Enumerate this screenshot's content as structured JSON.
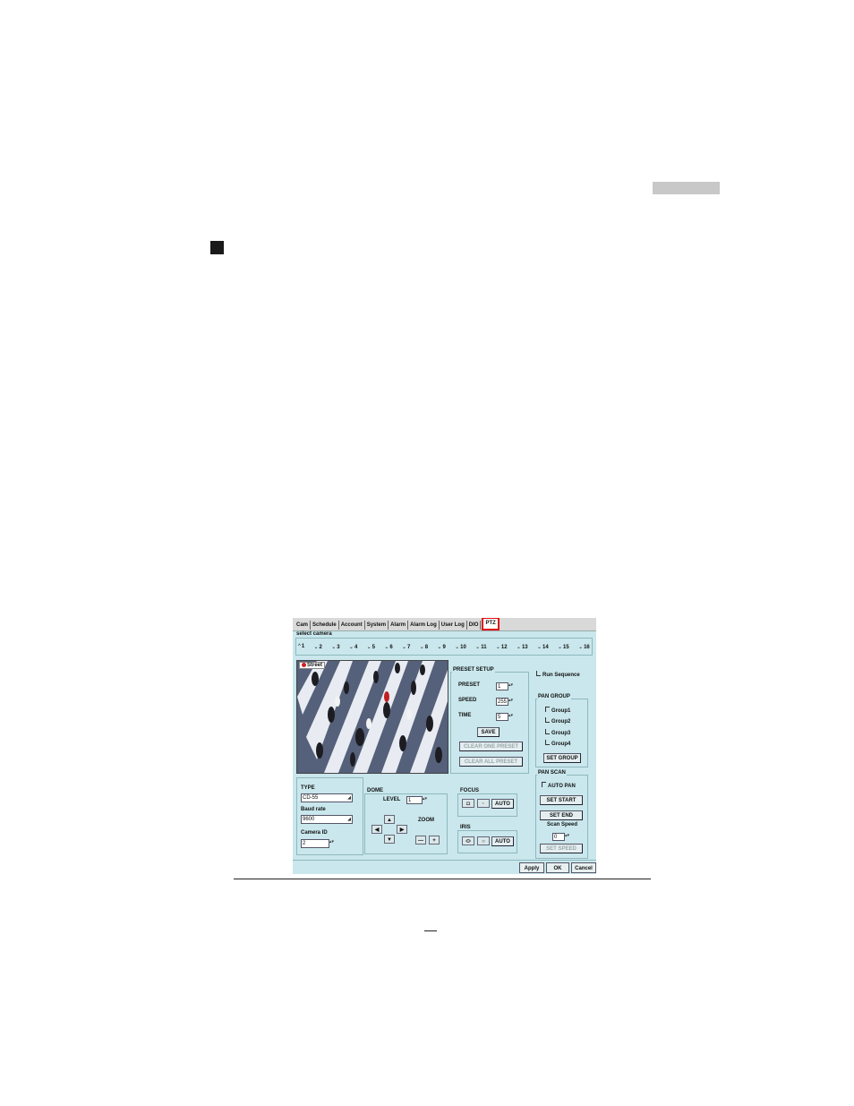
{
  "tabs": [
    {
      "label": "Cam"
    },
    {
      "label": "Schedule"
    },
    {
      "label": "Account"
    },
    {
      "label": "System"
    },
    {
      "label": "Alarm"
    },
    {
      "label": "Alarm Log"
    },
    {
      "label": "User Log"
    },
    {
      "label": "DIO"
    },
    {
      "label": "PTZ",
      "active": true
    }
  ],
  "select_camera_label": "select camera",
  "cameras": [
    "1",
    "2",
    "3",
    "4",
    "5",
    "6",
    "7",
    "8",
    "9",
    "10",
    "11",
    "12",
    "13",
    "14",
    "15",
    "16"
  ],
  "selected_camera": "1",
  "video": {
    "label": "Street"
  },
  "preset_setup": {
    "title": "PRESET SETUP",
    "preset_label": "PRESET",
    "preset_value": "1",
    "speed_label": "SPEED",
    "speed_value": "255",
    "time_label": "TIME",
    "time_value": "5",
    "save": "SAVE",
    "clear_one": "CLEAR ONE PRESET",
    "clear_all": "CLEAR ALL PRESET"
  },
  "run_sequence": "Run Sequence",
  "pan_group": {
    "title": "PAN GROUP",
    "groups": [
      {
        "label": "Group1",
        "checked": true
      },
      {
        "label": "Group2",
        "checked": false
      },
      {
        "label": "Group3",
        "checked": false
      },
      {
        "label": "Group4",
        "checked": false
      }
    ],
    "set_group": "SET GROUP"
  },
  "pan_scan": {
    "title": "PAN SCAN",
    "auto_pan": "AUTO PAN",
    "set_start": "SET START",
    "set_end": "SET END",
    "scan_speed_label": "Scan Speed",
    "scan_speed_value": "0",
    "set_speed": "SET SPEED"
  },
  "type": {
    "title": "TYPE",
    "value": "CD-55",
    "baud_label": "Baud rate",
    "baud_value": "9600",
    "camera_id_label": "Camera ID",
    "camera_id_value": "2"
  },
  "dome": {
    "title": "DOME",
    "level_label": "LEVEL",
    "level_value": "1",
    "zoom_label": "ZOOM",
    "zoom_minus": "—",
    "zoom_plus": "+"
  },
  "focus": {
    "title": "FOCUS",
    "auto": "AUTO"
  },
  "iris": {
    "title": "IRIS",
    "auto": "AUTO"
  },
  "footer": {
    "apply": "Apply",
    "ok": "OK",
    "cancel": "Cancel"
  },
  "colors": {
    "panel_bg": "#c9e7ec",
    "active_tab_border": "#e01010",
    "gray_bar": "#c8c8c8"
  }
}
